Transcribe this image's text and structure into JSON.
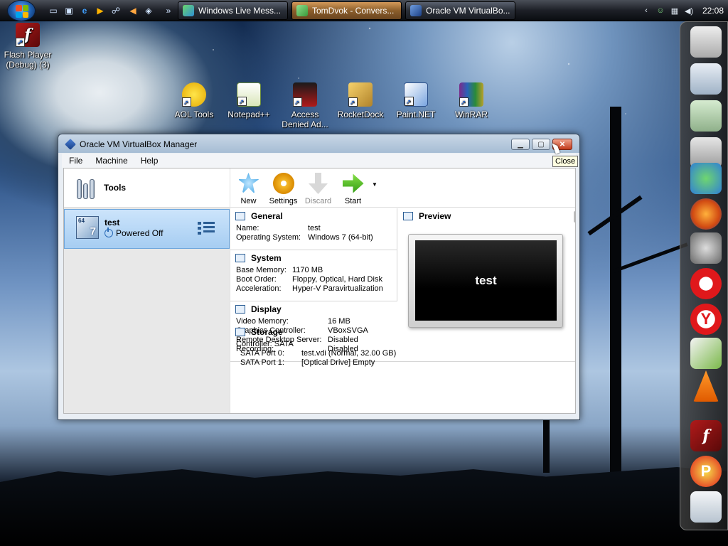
{
  "taskbar": {
    "tasks": [
      {
        "label": "Windows Live Mess..."
      },
      {
        "label": "TomDvok - Convers..."
      },
      {
        "label": "Oracle VM VirtualBo..."
      }
    ],
    "clock": "22:08",
    "overflow": "»"
  },
  "desktop": {
    "icons": [
      {
        "label": "Flash Player (Debug) (3)"
      },
      {
        "label": "AOL Tools"
      },
      {
        "label": "Notepad++"
      },
      {
        "label": "Access Denied Ad..."
      },
      {
        "label": "RocketDock"
      },
      {
        "label": "Paint.NET"
      },
      {
        "label": "WinRAR"
      }
    ]
  },
  "window": {
    "title": "Oracle VM VirtualBox Manager",
    "tooltip": "Close",
    "menu": [
      "File",
      "Machine",
      "Help"
    ],
    "tools_label": "Tools",
    "vm": {
      "name": "test",
      "state": "Powered Off",
      "os_badge": "64"
    },
    "toolbar": [
      {
        "label": "New"
      },
      {
        "label": "Settings"
      },
      {
        "label": "Discard"
      },
      {
        "label": "Start"
      }
    ],
    "general": {
      "title": "General",
      "rows": [
        {
          "k": "Name:",
          "v": "test"
        },
        {
          "k": "Operating System:",
          "v": "Windows 7 (64-bit)"
        }
      ]
    },
    "system": {
      "title": "System",
      "rows": [
        {
          "k": "Base Memory:",
          "v": "1170 MB"
        },
        {
          "k": "Boot Order:",
          "v": "Floppy, Optical, Hard Disk"
        },
        {
          "k": "Acceleration:",
          "v": "Hyper-V Paravirtualization"
        }
      ]
    },
    "display": {
      "title": "Display",
      "rows": [
        {
          "k": "Video Memory:",
          "v": "16 MB"
        },
        {
          "k": "Graphics Controller:",
          "v": "VBoxSVGA"
        },
        {
          "k": "Remote Desktop Server:",
          "v": "Disabled"
        },
        {
          "k": "Recording:",
          "v": "Disabled"
        }
      ]
    },
    "storage": {
      "title": "Storage",
      "rows": [
        {
          "k": "Controller: SATA",
          "v": ""
        },
        {
          "k": "SATA Port 0:",
          "v": "test.vdi (Normal, 32.00 GB)"
        },
        {
          "k": "SATA Port 1:",
          "v": "[Optical Drive] Empty"
        }
      ]
    },
    "preview": {
      "title": "Preview",
      "screen_text": "test"
    }
  }
}
